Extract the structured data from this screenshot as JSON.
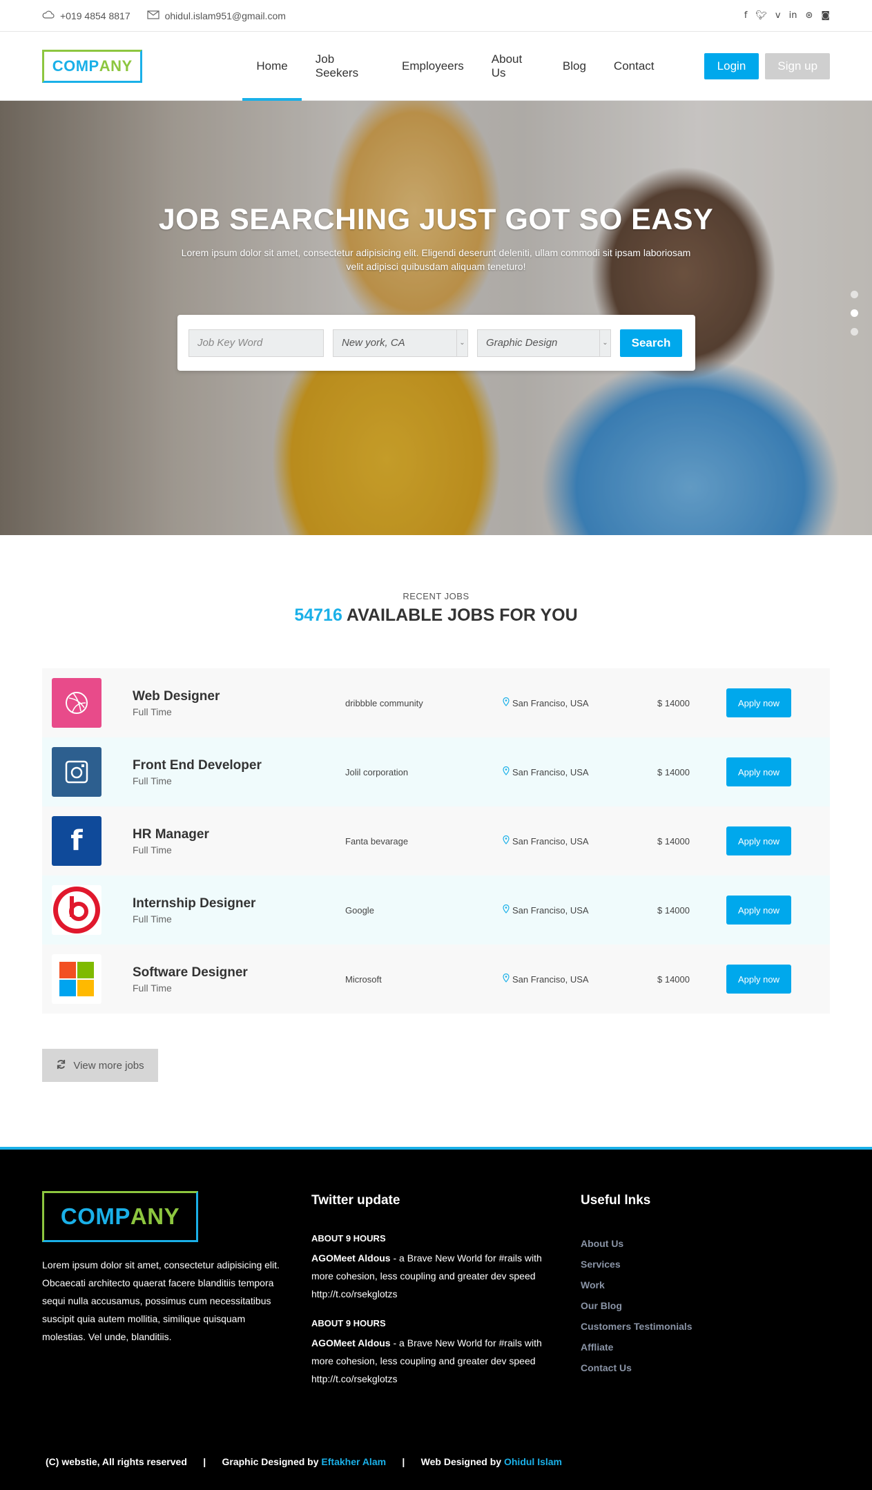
{
  "topbar": {
    "phone": "+019 4854 8817",
    "email": "ohidul.islam951@gmail.com",
    "social_icons": [
      "facebook-icon",
      "twitter-icon",
      "vimeo-icon",
      "linkedin-icon",
      "dribbble-icon",
      "instagram-icon"
    ]
  },
  "header": {
    "logo_part1": "COMP",
    "logo_part2": "ANY",
    "nav": [
      "Home",
      "Job Seekers",
      "Employeers",
      "About Us",
      "Blog",
      "Contact"
    ],
    "active_nav": "Home",
    "login": "Login",
    "signup": "Sign up"
  },
  "hero": {
    "title": "JOB SEARCHING JUST GOT SO EASY",
    "text": "Lorem ipsum dolor sit amet, consectetur adipisicing elit. Eligendi deserunt deleniti, ullam commodi sit ipsam laboriosam velit adipisci quibusdam aliquam teneturo!",
    "keyword_placeholder": "Job Key Word",
    "location_value": "New york, CA",
    "category_value": "Graphic Design",
    "search_button": "Search",
    "slide_count": 3,
    "active_slide": 2
  },
  "jobs": {
    "section_label": "RECENT JOBS",
    "count": "54716",
    "heading": "AVAILABLE JOBS FOR YOU",
    "apply_label": "Apply now",
    "items": [
      {
        "title": "Web Designer",
        "type": "Full Time",
        "company": "dribbble community",
        "location": "San Franciso, USA",
        "salary": "$ 14000",
        "logo": "dribbble-icon"
      },
      {
        "title": "Front End Developer",
        "type": "Full Time",
        "company": "Jolil corporation",
        "location": "San Franciso, USA",
        "salary": "$ 14000",
        "logo": "instagram-icon"
      },
      {
        "title": "HR Manager",
        "type": "Full Time",
        "company": "Fanta bevarage",
        "location": "San Franciso, USA",
        "salary": "$ 14000",
        "logo": "facebook-icon"
      },
      {
        "title": "Internship Designer",
        "type": "Full Time",
        "company": "Google",
        "location": "San Franciso, USA",
        "salary": "$ 14000",
        "logo": "beats-icon"
      },
      {
        "title": "Software Designer",
        "type": "Full Time",
        "company": "Microsoft",
        "location": "San Franciso, USA",
        "salary": "$ 14000",
        "logo": "microsoft-icon"
      }
    ],
    "view_more": "View more jobs"
  },
  "footer": {
    "logo_part1": "COMP",
    "logo_part2": "ANY",
    "about": "Lorem ipsum dolor sit amet, consectetur adipisicing elit. Obcaecati architecto quaerat facere blanditiis tempora sequi nulla accusamus, possimus cum necessitatibus suscipit quia autem mollitia, similique quisquam molestias. Vel unde, blanditiis.",
    "twitter_heading": "Twitter update",
    "tweets": [
      {
        "time": "ABOUT 9 HOURS",
        "author": "AGOMeet Aldous",
        "text": " - a Brave New World for #rails with more cohesion, less coupling and greater dev speed http://t.co/rsekglotzs"
      },
      {
        "time": "ABOUT 9 HOURS",
        "author": "AGOMeet Aldous",
        "text": " - a Brave New World for #rails with more cohesion, less coupling and greater dev speed http://t.co/rsekglotzs"
      }
    ],
    "links_heading": "Useful lnks",
    "links": [
      "About Us",
      "Services",
      "Work",
      "Our Blog",
      "Customers Testimonials",
      "Affliate",
      "Contact Us"
    ],
    "copyright": "(C) webstie, All rights reserved",
    "separator": "|",
    "graphic_label": "Graphic Designed by ",
    "graphic_name": "Eftakher Alam",
    "web_label": "Web Designed by ",
    "web_name": "Ohidul Islam"
  },
  "colors": {
    "accent": "#1ab0e8",
    "button_blue": "#00a8ec",
    "logo_green": "#8dc63f",
    "signup_gray": "#cfcfcf",
    "footer_bg": "#000000"
  }
}
